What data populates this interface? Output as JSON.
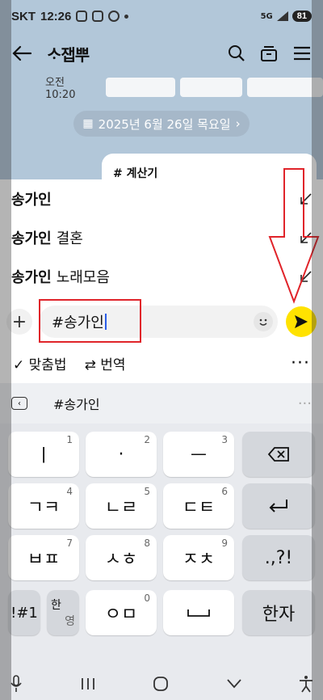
{
  "status": {
    "carrier": "SKT",
    "time": "12:26",
    "network": "5G",
    "battery": "81"
  },
  "chat": {
    "title": "ᄉᆞ잽뿌",
    "preview_time": "오전 10:20",
    "date_pill": "2025년 6월 26일 목요일",
    "bubble_tag": "# 계산기"
  },
  "suggestions": [
    {
      "bold": "송가인",
      "rest": ""
    },
    {
      "bold": "송가인",
      "rest": "결혼"
    },
    {
      "bold": "송가인",
      "rest": "노래모음"
    }
  ],
  "input": {
    "value": "#송가인"
  },
  "tools": {
    "spell": "맞춤법",
    "translate": "번역",
    "more": "···"
  },
  "keyboard_header": {
    "text": "#송가인",
    "more": "···"
  },
  "keys": {
    "r1": [
      {
        "label": "ㅣ",
        "num": "1"
      },
      {
        "label": "·",
        "num": "2"
      },
      {
        "label": "ㅡ",
        "num": "3"
      }
    ],
    "r2": [
      {
        "label": "ㄱㅋ",
        "num": "4"
      },
      {
        "label": "ㄴㄹ",
        "num": "5"
      },
      {
        "label": "ㄷㅌ",
        "num": "6"
      }
    ],
    "r3": [
      {
        "label": "ㅂㅍ",
        "num": "7"
      },
      {
        "label": "ㅅㅎ",
        "num": "8"
      },
      {
        "label": "ㅈㅊ",
        "num": "9"
      }
    ],
    "sym": ".,?!",
    "special": "!#1",
    "lang_top": "한",
    "lang_bottom": "영",
    "zero": {
      "label": "ㅇㅁ",
      "num": "0"
    },
    "hanja": "한자"
  },
  "colors": {
    "send": "#ffe200",
    "chat_bg": "#b2c7d9",
    "annotation": "#e0242a"
  }
}
